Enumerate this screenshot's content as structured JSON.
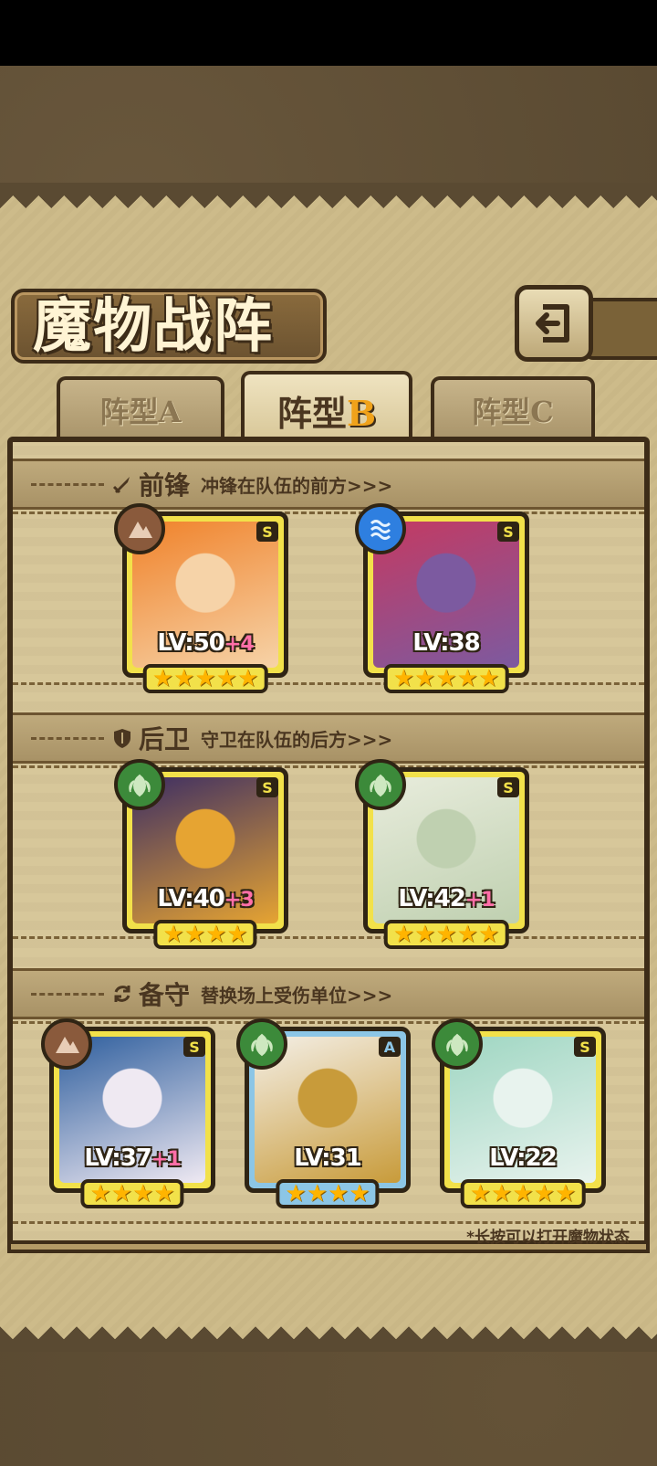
{
  "header": {
    "title": "魔物战阵"
  },
  "tabs": [
    {
      "label_prefix": "阵型",
      "label_suffix": "A",
      "active": false
    },
    {
      "label_prefix": "阵型",
      "label_suffix": "B",
      "active": true
    },
    {
      "label_prefix": "阵型",
      "label_suffix": "C",
      "active": false
    }
  ],
  "sections": {
    "front": {
      "name": "前锋",
      "desc": "冲锋在队伍的前方>>>",
      "icon": "sword-icon"
    },
    "rear": {
      "name": "后卫",
      "desc": "守卫在队伍的后方>>>",
      "icon": "shield-icon"
    },
    "reserve": {
      "name": "备守",
      "desc": "替换场上受伤单位>>>",
      "icon": "swap-icon"
    }
  },
  "cards": {
    "front1": {
      "rank": "S",
      "lv": "LV:50",
      "plus": "+4",
      "stars": "★★★★★",
      "element": "earth-icon",
      "colors": [
        "#f0822a",
        "#f6d3a8"
      ]
    },
    "front2": {
      "rank": "S",
      "lv": "LV:38",
      "plus": "",
      "stars": "★★★★★",
      "element": "water-icon",
      "colors": [
        "#c43a62",
        "#7c5aa0"
      ]
    },
    "rear1": {
      "rank": "S",
      "lv": "LV:40",
      "plus": "+3",
      "stars": "★★★★",
      "element": "wood-icon",
      "colors": [
        "#3d2e63",
        "#e6a432"
      ]
    },
    "rear2": {
      "rank": "S",
      "lv": "LV:42",
      "plus": "+1",
      "stars": "★★★★★",
      "element": "wood-icon",
      "colors": [
        "#e8ecdc",
        "#bfd0b0"
      ]
    },
    "res1": {
      "rank": "S",
      "lv": "LV:37",
      "plus": "+1",
      "stars": "★★★★",
      "element": "earth-icon",
      "colors": [
        "#2f5f9e",
        "#efe9f2"
      ]
    },
    "res2": {
      "rank": "A",
      "lv": "LV:31",
      "plus": "",
      "stars": "★★★★",
      "element": "wood-icon",
      "colors": [
        "#f4efe6",
        "#c89b3a"
      ]
    },
    "res3": {
      "rank": "S",
      "lv": "LV:22",
      "plus": "",
      "stars": "★★★★★",
      "element": "wood-icon",
      "colors": [
        "#9fd6c2",
        "#e8f3ee"
      ]
    }
  },
  "footer": {
    "hint": "*长按可以打开魔物状态"
  },
  "theme": {
    "parchment": "#cdbb8a",
    "dark": "#3d2c18",
    "s_frame": "#f2e14a",
    "a_frame": "#8cc6e6",
    "plus": "#ff6fa8"
  }
}
